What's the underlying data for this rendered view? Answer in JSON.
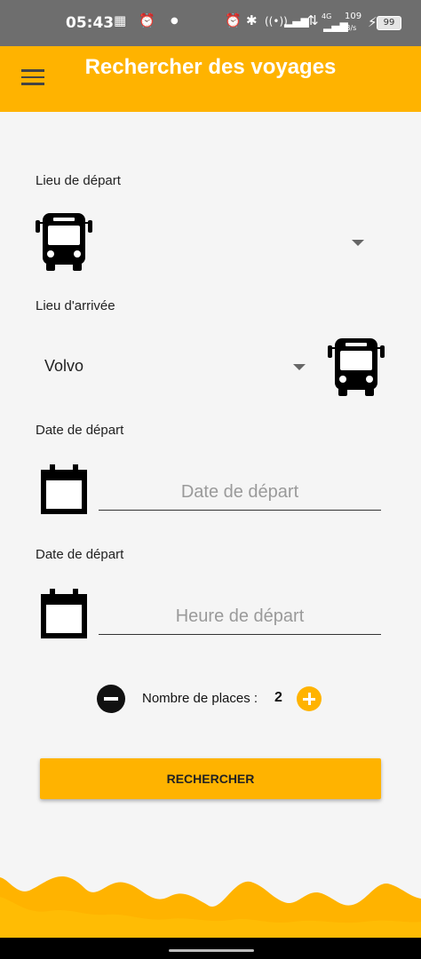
{
  "status_bar": {
    "time": "05:43",
    "data_speed": "109",
    "data_unit": "B/s",
    "network": "4G",
    "battery": "99"
  },
  "app_bar": {
    "title": "Rechercher des voyages",
    "menu_icon": "hamburger-icon"
  },
  "form": {
    "departure": {
      "label": "Lieu de départ",
      "value": "",
      "icon": "bus-icon"
    },
    "arrival": {
      "label": "Lieu d'arrivée",
      "value": "Volvo",
      "icon": "bus-icon"
    },
    "date": {
      "label": "Date de départ",
      "placeholder": "Date de départ",
      "icon": "calendar-icon"
    },
    "time": {
      "label": "Date de départ",
      "placeholder": "Heure de départ",
      "icon": "calendar-icon"
    },
    "seats": {
      "label": "Nombre de places :",
      "count": "2"
    },
    "submit_label": "RECHERCHER"
  },
  "colors": {
    "accent": "#ffb300",
    "status_bar": "#6e6e6e"
  }
}
